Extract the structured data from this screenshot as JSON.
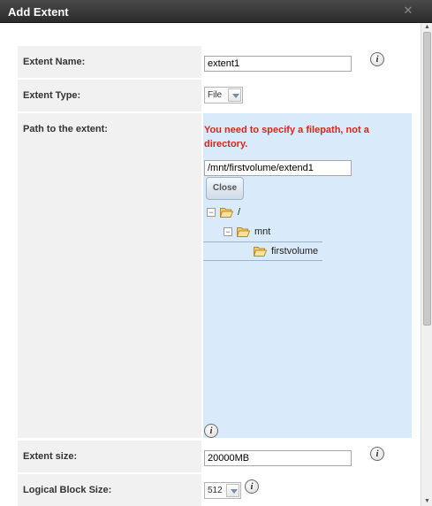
{
  "dialog": {
    "title": "Add Extent"
  },
  "fields": {
    "extent_name": {
      "label": "Extent Name:",
      "value": "extent1"
    },
    "extent_type": {
      "label": "Extent Type:",
      "selected": "File"
    },
    "path": {
      "label": "Path to the extent:",
      "error": "You need to specify a filepath, not a directory.",
      "value": "/mnt/firstvolume/extend1",
      "close_label": "Close",
      "tree": [
        {
          "name": "/",
          "toggle": "−"
        },
        {
          "name": "mnt",
          "toggle": "−"
        },
        {
          "name": "firstvolume"
        }
      ]
    },
    "extent_size": {
      "label": "Extent size:",
      "value": "20000MB"
    },
    "block_size": {
      "label": "Logical Block Size:",
      "selected": "512"
    }
  },
  "info_icon_glyph": "i",
  "close_glyph": "✕",
  "icons": [
    "close-icon",
    "info-icon",
    "folder-open-icon",
    "collapse-icon",
    "chevron-down-icon"
  ]
}
